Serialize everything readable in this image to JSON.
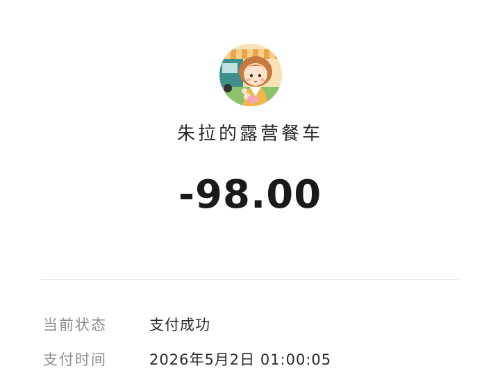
{
  "merchant": {
    "name": "朱拉的露营餐车",
    "avatar_icon": "merchant-avatar-illustration"
  },
  "transaction": {
    "amount": "-98.00"
  },
  "details": [
    {
      "label": "当前状态",
      "value": "支付成功"
    },
    {
      "label": "支付时间",
      "value": "2026年5月2日 01:00:05"
    }
  ],
  "colors": {
    "background": "#ffffff",
    "label": "#8c8c8c",
    "value": "#2a2a2a",
    "divider": "#ececec"
  }
}
